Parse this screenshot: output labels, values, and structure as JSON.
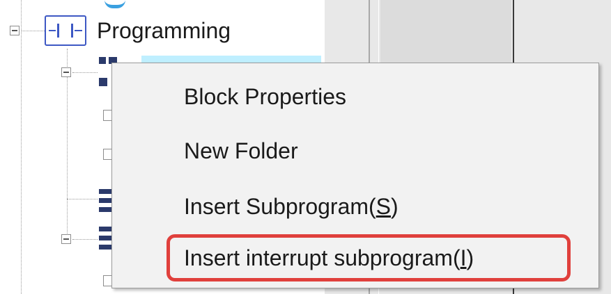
{
  "tree": {
    "root_label": "Programming",
    "root_icon": "ladder-contact-icon",
    "accent": "#3d58c4",
    "selection_color": "#bfefff"
  },
  "context_menu": {
    "items": [
      {
        "pre": "Block Properties",
        "accel": "",
        "post": ""
      },
      {
        "pre": "New Folder",
        "accel": "",
        "post": ""
      },
      {
        "pre": "Insert Subprogram(",
        "accel": "S",
        "post": ")"
      },
      {
        "pre": "Insert interrupt subprogram(",
        "accel": "I",
        "post": ")"
      }
    ],
    "highlighted_index": 3,
    "highlight_color": "#e0403c"
  }
}
